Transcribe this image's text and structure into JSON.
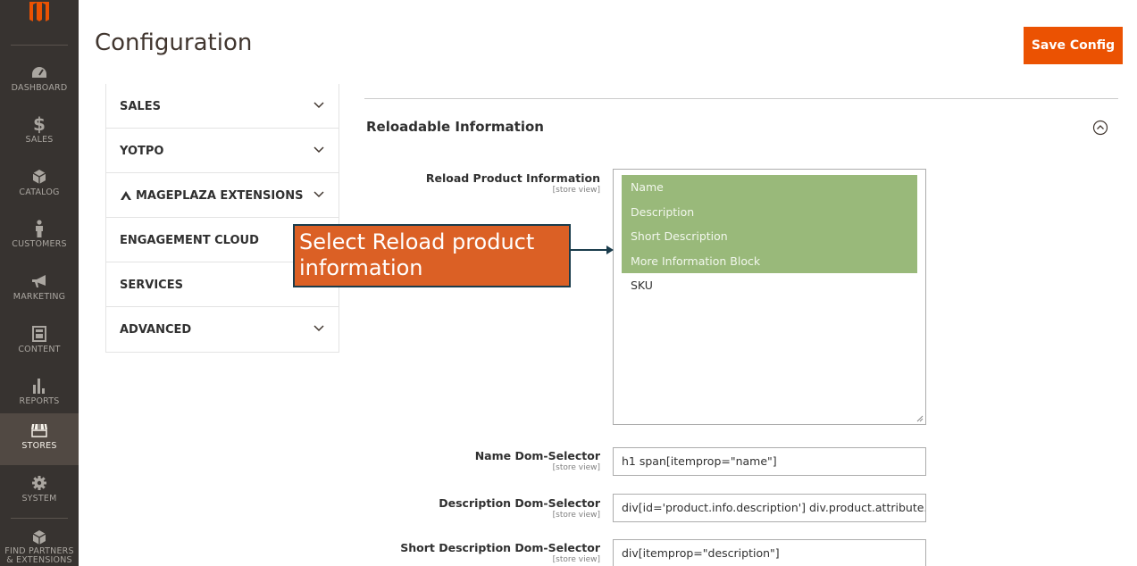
{
  "nav": {
    "items": [
      {
        "label": "DASHBOARD",
        "icon": "dashboard-icon"
      },
      {
        "label": "SALES",
        "icon": "dollar-icon"
      },
      {
        "label": "CATALOG",
        "icon": "cube-icon"
      },
      {
        "label": "CUSTOMERS",
        "icon": "person-icon"
      },
      {
        "label": "MARKETING",
        "icon": "megaphone-icon"
      },
      {
        "label": "CONTENT",
        "icon": "layout-icon"
      },
      {
        "label": "REPORTS",
        "icon": "bar-chart-icon"
      },
      {
        "label": "STORES",
        "icon": "store-icon"
      },
      {
        "label": "SYSTEM",
        "icon": "gear-icon"
      },
      {
        "label": "FIND PARTNERS\n& EXTENSIONS",
        "icon": "extensions-icon"
      }
    ]
  },
  "header": {
    "title": "Configuration",
    "save_label": "Save Config"
  },
  "tabs": [
    {
      "label": "SALES"
    },
    {
      "label": "YOTPO"
    },
    {
      "label": "MAGEPLAZA EXTENSIONS"
    },
    {
      "label": "ENGAGEMENT CLOUD"
    },
    {
      "label": "SERVICES"
    },
    {
      "label": "ADVANCED"
    }
  ],
  "section": {
    "title": "Reloadable Information"
  },
  "fields": {
    "reload": {
      "label": "Reload Product Information",
      "scope": "[store view]",
      "options": [
        {
          "label": "Name",
          "selected": true
        },
        {
          "label": "Description",
          "selected": true
        },
        {
          "label": "Short Description",
          "selected": true
        },
        {
          "label": "More Information Block",
          "selected": true
        },
        {
          "label": "SKU",
          "selected": false
        }
      ]
    },
    "name_selector": {
      "label": "Name Dom-Selector",
      "scope": "[store view]",
      "value": "h1 span[itemprop=\"name\"]"
    },
    "description_selector": {
      "label": "Description Dom-Selector",
      "scope": "[store view]",
      "value": "div[id='product.info.description'] div.product.attribute.description"
    },
    "short_description_selector": {
      "label": "Short Description Dom-Selector",
      "scope": "[store view]",
      "value": "div[itemprop=\"description\"]"
    }
  },
  "callout": {
    "line1": "Select Reload product",
    "line2": "information"
  },
  "colors": {
    "nav_bg": "#373330",
    "accent": "#eb5202",
    "selected_option": "#99b97a",
    "callout_bg": "#db6025",
    "callout_border": "#1a3c4c"
  }
}
